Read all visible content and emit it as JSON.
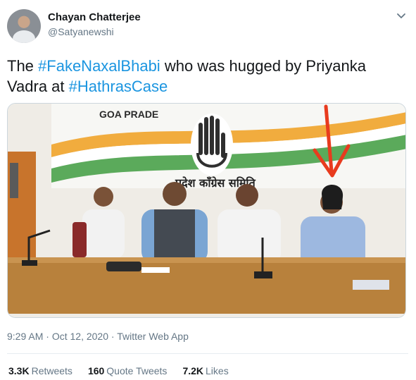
{
  "user": {
    "name": "Chayan Chatterjee",
    "handle": "@Satyanewshi"
  },
  "tweet": {
    "text_1": "The ",
    "hashtag_1": "#FakeNaxalBhabi",
    "text_2": " who was hugged by Priyanka Vadra at ",
    "hashtag_2": "#HathrasCase"
  },
  "media": {
    "banner_text_english": "GOA PRADE",
    "banner_text_hindi": "प्रदेश कॉंग्रेस समिति"
  },
  "meta": {
    "time": "9:29 AM",
    "sep1": " · ",
    "date": "Oct 12, 2020",
    "sep2": " · ",
    "source": "Twitter Web App"
  },
  "stats": {
    "retweets_count": "3.3K",
    "retweets_label": "Retweets",
    "quotes_count": "160",
    "quotes_label": "Quote Tweets",
    "likes_count": "7.2K",
    "likes_label": "Likes"
  },
  "colors": {
    "link": "#1b95e0",
    "secondary": "#657786"
  },
  "icons": {
    "caret": "chevron-down-icon",
    "avatar": "avatar"
  }
}
